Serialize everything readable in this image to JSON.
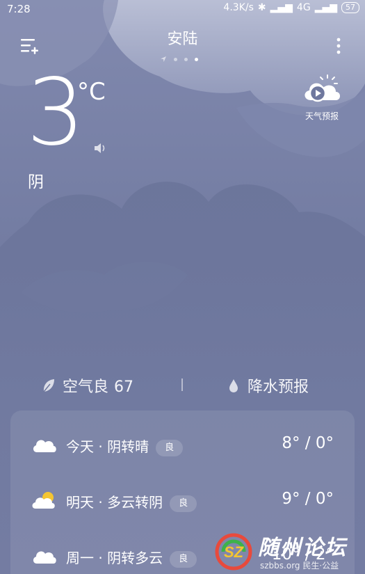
{
  "status_bar": {
    "time": "7:28",
    "net_speed": "4.3K/s",
    "network": "4G",
    "battery": "57"
  },
  "header": {
    "city": "安陆",
    "pages_total": 4,
    "active_page": 4
  },
  "forecast_video_label": "天气预报",
  "current": {
    "temperature": "3",
    "unit": "°C",
    "condition": "阴"
  },
  "info": {
    "air_quality_label": "空气良",
    "air_quality_value": "67",
    "precipitation_label": "降水预报"
  },
  "daily": [
    {
      "name": "今天 · 阴转晴",
      "aq": "良",
      "temps": "8° / 0°",
      "icon": "cloud-icon"
    },
    {
      "name": "明天 · 多云转阴",
      "aq": "良",
      "temps": "9° / 0°",
      "icon": "partly-cloudy-icon"
    },
    {
      "name": "周一 · 阴转多云",
      "aq": "良",
      "temps": "10° / 2°",
      "icon": "cloud-icon"
    }
  ],
  "watermark": {
    "title": "随州论坛",
    "subtitle": "szbbs.org 民生·公益"
  },
  "colors": {
    "sky_bg": "#6d769c",
    "cloud": "#7b84a9",
    "sun": "#f4c531"
  }
}
